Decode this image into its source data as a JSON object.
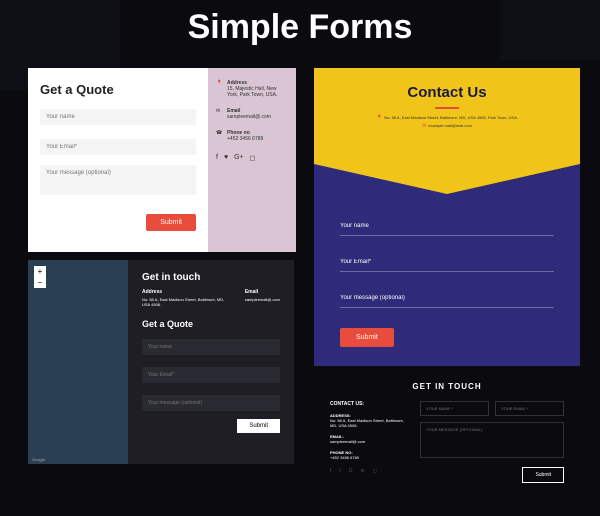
{
  "header": "Simple Forms",
  "card1": {
    "title": "Get a Quote",
    "name_ph": "Your name",
    "email_ph": "Your Email*",
    "msg_ph": "Your message (optional)",
    "submit": "Submit",
    "addr_label": "Address",
    "addr": "15, Majestic Hall, New York, Park Town, USA.",
    "email_label": "Email",
    "email": "sampleemail@.com",
    "phone_label": "Phone no",
    "phone": "+452 3456 6789"
  },
  "card2": {
    "title": "Contact Us",
    "addr": "No: 58 A, East Madison Street, Baltimore, MD, USA 4508. Park Town, USA.",
    "email": "example.mail@mail.com",
    "name_ph": "Your name",
    "email_ph": "Your Email*",
    "msg_ph": "Your message (optional)",
    "submit": "Submit"
  },
  "card3": {
    "title": "Get in touch",
    "addr_label": "Address",
    "addr": "No: 58 A, East Madison Street, Baltimore, MD, USA 4508.",
    "email_label": "Email",
    "email": "sampleemail@.com",
    "quote_title": "Get a Quote",
    "name_ph": "Your name",
    "email_ph": "Your Email*",
    "msg_ph": "Your message (optional)",
    "submit": "Submit",
    "map_attrib": "Google",
    "zoom_in": "+",
    "zoom_out": "−"
  },
  "card4": {
    "head": "GET IN TOUCH",
    "contact_label": "CONTACT US:",
    "addr_label": "ADDRESS:",
    "addr": "No: 58 A, East Madison Street, Baltimore, MD, USA 4508.",
    "email_label": "EMAIL:",
    "email": "sampleemail@.com",
    "phone_label": "PHONE NO:",
    "phone": "+452 3456 6789",
    "name_ph": "YOUR NAME *",
    "email_ph": "YOUR EMAIL *",
    "msg_ph": "YOUR MESSAGE (OPTIONAL)",
    "submit": "Submit"
  }
}
